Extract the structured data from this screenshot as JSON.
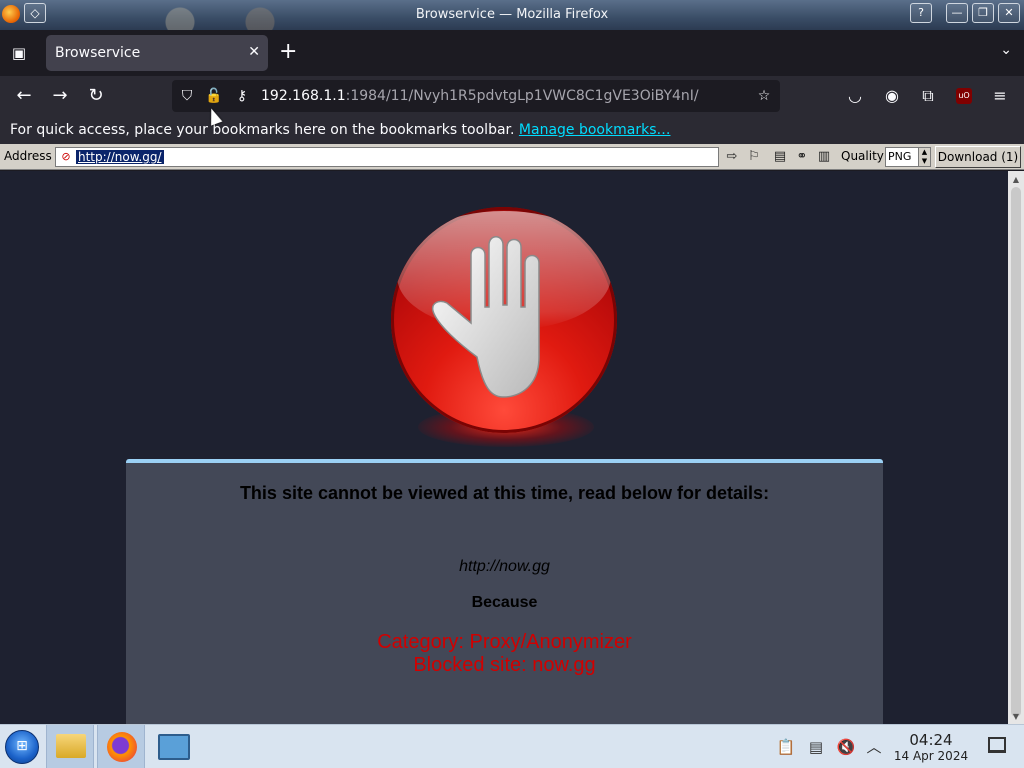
{
  "window": {
    "title": "Browservice — Mozilla Firefox",
    "btn_help": "?",
    "btn_minimize": "—",
    "btn_maximize": "❐",
    "btn_close": "✕"
  },
  "tabs": [
    {
      "label": "Browservice",
      "active": true
    }
  ],
  "urlbar": {
    "host": "192.168.1.1",
    "path": ":1984/11/Nvyh1R5pdvtgLp1VWC8C1gVE3OiBY4nI/"
  },
  "bookmarks_bar": {
    "prompt": "For quick access, place your bookmarks here on the bookmarks toolbar.",
    "manage_link": "Manage bookmarks…"
  },
  "browservice_bar": {
    "address_label": "Address",
    "address_value": "http://now.gg/",
    "quality_label": "Quality",
    "quality_value": "PNG",
    "download_label": "Download (1)"
  },
  "page": {
    "heading": "This site cannot be viewed at this time, read below for details:",
    "blocked_url": "http://now.gg",
    "because": "Because",
    "category": "Category: Proxy/Anonymizer",
    "blocked_site": "Blocked site: now.gg",
    "error_color": "#d10000",
    "panel_accent": "#9bd1f5"
  },
  "taskbar": {
    "time": "04:24",
    "date": "14 Apr 2024"
  }
}
